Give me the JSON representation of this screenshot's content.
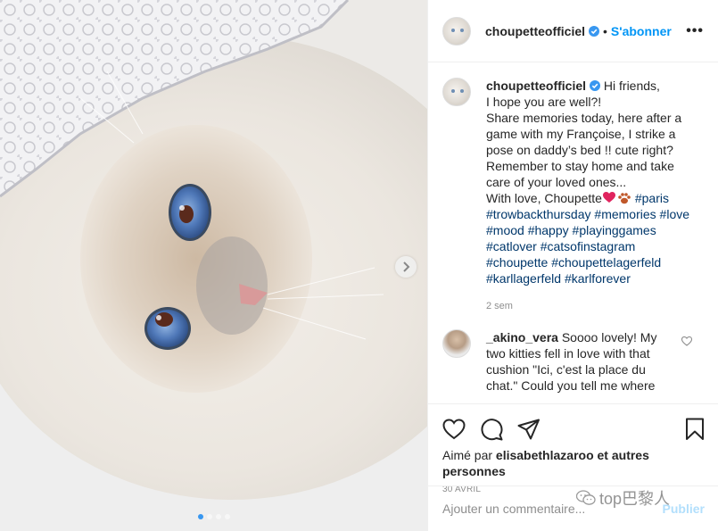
{
  "post": {
    "username": "choupetteofficiel",
    "follow_label": "S'abonner",
    "separator": "•",
    "more_label": "•••",
    "caption_lines": [
      "Hi friends,",
      "I hope you are well?!",
      "Share memories today, here after a game with my Françoise, I strike a pose on daddy’s bed !! cute right? Remember to stay home and take care of your loved ones...",
      "With love, Choupette"
    ],
    "hashtags": [
      "#paris",
      "#trowbackthursday",
      "#memories",
      "#love",
      "#mood",
      "#happy",
      "#playinggames",
      "#catlover",
      "#catsofinstagram",
      "#choupette",
      "#choupettelagerfeld",
      "#karllagerfeld",
      "#karlforever"
    ],
    "time_ago": "2 sem"
  },
  "comment": {
    "username": "_akino_vera",
    "text": "Soooo lovely! My two kitties fell in love with that cushion \"Ici, c'est la place du chat.\" Could you tell me where"
  },
  "likes": {
    "prefix": "Aimé par",
    "user": "elisabethlazaroo",
    "suffix": "et autres personnes"
  },
  "date": "30 AVRIL",
  "add_comment": {
    "placeholder": "Ajouter un commentaire...",
    "publish_label": "Publier"
  },
  "watermark": "top巴黎人",
  "carousel": {
    "slides": 4,
    "active": 0
  },
  "colors": {
    "accent": "#0095f6",
    "hashtag": "#00376b",
    "verified": "#3897f0",
    "heart_emoji": "#e0245e"
  },
  "icons": [
    "verified-icon",
    "chevron-right-icon",
    "heart-icon",
    "comment-icon",
    "share-icon",
    "bookmark-icon",
    "small-heart-icon",
    "wechat-icon"
  ]
}
